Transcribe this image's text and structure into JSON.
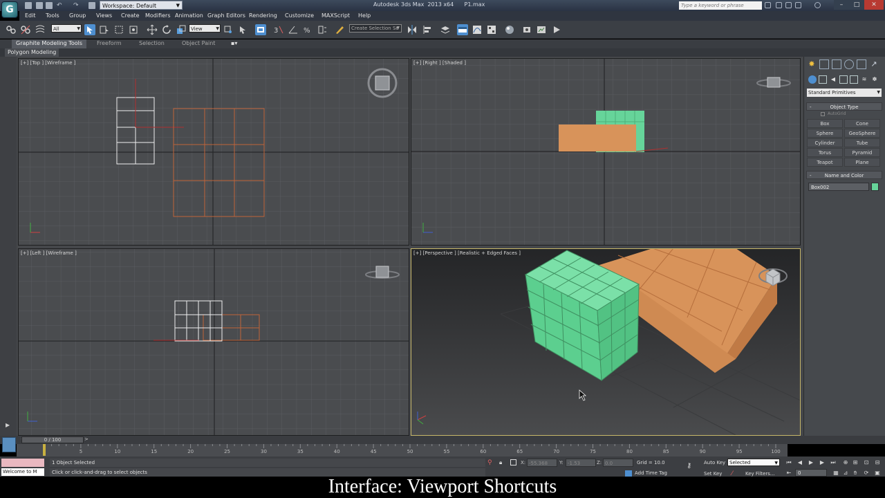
{
  "window": {
    "title": "Autodesk 3ds Max  2013 x64      P1.max",
    "workspace": "Workspace: Default",
    "search_placeholder": "Type a keyword or phrase"
  },
  "menu": [
    "Edit",
    "Tools",
    "Group",
    "Views",
    "Create",
    "Modifiers",
    "Animation",
    "Graph Editors",
    "Rendering",
    "Customize",
    "MAXScript",
    "Help"
  ],
  "toolbar": {
    "selection_filter": "All",
    "reference_coord": "View",
    "selection_set": "Create Selection Se"
  },
  "ribbon": {
    "tabs": [
      "Graphite Modeling Tools",
      "Freeform",
      "Selection",
      "Object Paint"
    ],
    "active_tab": "Graphite Modeling Tools",
    "panel": "Polygon Modeling"
  },
  "viewports": {
    "top": "[+] [Top ] [Wireframe ]",
    "right": "[+] [Right ] [Shaded ]",
    "left": "[+] [Left ] [Wireframe ]",
    "perspective": "[+] [Perspective ] [Realistic + Edged Faces ]"
  },
  "command_panel": {
    "dropdown": "Standard Primitives",
    "object_type_title": "Object Type",
    "autogrid": "AutoGrid",
    "primitives": [
      "Box",
      "Cone",
      "Sphere",
      "GeoSphere",
      "Cylinder",
      "Tube",
      "Torus",
      "Pyramid",
      "Teapot",
      "Plane"
    ],
    "name_color_title": "Name and Color",
    "object_name": "Box002",
    "object_color": "#66d49a"
  },
  "timeline": {
    "frame_display": "0 / 100",
    "ticks": [
      "0",
      "5",
      "10",
      "15",
      "20",
      "25",
      "30",
      "35",
      "40",
      "45",
      "50",
      "55",
      "60",
      "65",
      "70",
      "75",
      "80",
      "85",
      "90",
      "95",
      "100"
    ]
  },
  "status": {
    "listener_output": "Welcome to M",
    "selection": "1 Object Selected",
    "prompt": "Click or click-and-drag to select objects",
    "x_label": "X:",
    "x_value": "-55.368",
    "y_label": "Y:",
    "y_value": "-1.53",
    "z_label": "Z:",
    "z_value": "0.0",
    "grid": "Grid = 10.0",
    "add_time_tag": "Add Time Tag",
    "auto_key": "Auto Key",
    "set_key": "Set Key",
    "key_mode": "Selected",
    "key_filters": "Key Filters...",
    "current_frame": "0"
  },
  "caption": "Interface: Viewport Shortcuts",
  "colors": {
    "box_green": "#66d49a",
    "box_orange": "#d8935a",
    "wire_orange": "#c0643a",
    "active_viewport": "#c8b86a",
    "active_tool": "#4e8fd0"
  }
}
